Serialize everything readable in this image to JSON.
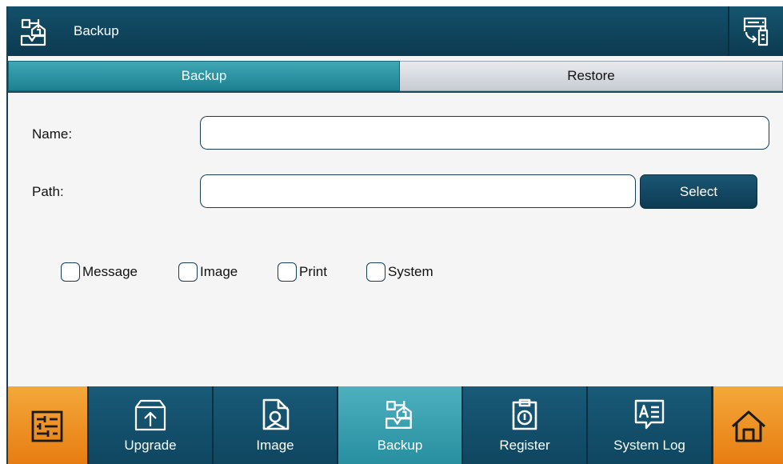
{
  "header": {
    "title": "Backup",
    "app_icon": "backup-icon",
    "right_icon": "usb-backup-icon"
  },
  "tabs": [
    {
      "label": "Backup",
      "active": true
    },
    {
      "label": "Restore",
      "active": false
    }
  ],
  "form": {
    "name_label": "Name:",
    "name_value": "",
    "path_label": "Path:",
    "path_value": "",
    "select_label": "Select"
  },
  "checkboxes": [
    {
      "label": "Message",
      "checked": false
    },
    {
      "label": "Image",
      "checked": false
    },
    {
      "label": "Print",
      "checked": false
    },
    {
      "label": "System",
      "checked": false
    }
  ],
  "bottom_nav": {
    "left_icon": "settings-sliders-icon",
    "right_icon": "home-icon",
    "items": [
      {
        "label": "Upgrade",
        "icon": "upgrade-icon",
        "active": false
      },
      {
        "label": "Image",
        "icon": "image-icon",
        "active": false
      },
      {
        "label": "Backup",
        "icon": "backup-icon",
        "active": true
      },
      {
        "label": "Register",
        "icon": "register-icon",
        "active": false
      },
      {
        "label": "System Log",
        "icon": "system-log-icon",
        "active": false
      }
    ]
  },
  "colors": {
    "primary": "#0f4660",
    "accent": "#278fa0",
    "orange": "#e77d12"
  }
}
